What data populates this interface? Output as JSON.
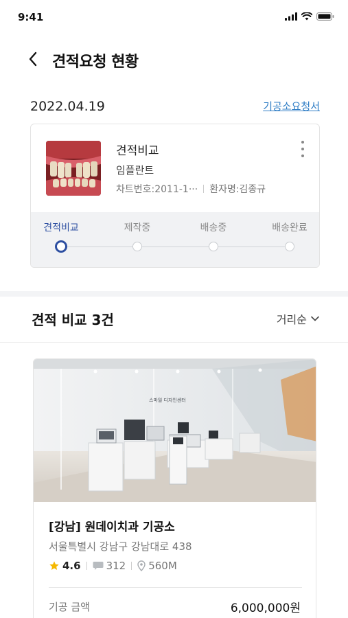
{
  "status": {
    "time": "9:41"
  },
  "header": {
    "title": "견적요청 현황"
  },
  "date_row": {
    "date": "2022.04.19",
    "request_link": "기공소요청서"
  },
  "order": {
    "title": "견적비교",
    "type": "임플란트",
    "chart_no": "차트번호:2011-1···",
    "patient": "환자명:김종규",
    "steps": [
      {
        "label": "견적비교",
        "active": true
      },
      {
        "label": "제작중",
        "active": false
      },
      {
        "label": "배송중",
        "active": false
      },
      {
        "label": "배송완료",
        "active": false
      }
    ]
  },
  "compare": {
    "title": "견적 비교 3건",
    "sort": "거리순"
  },
  "lab": {
    "name": "[강남] 원데이치과 기공소",
    "address": "서울특별시 강남구 강남대로 438",
    "rating": "4.6",
    "reviews": "312",
    "distance": "560M",
    "price_label": "기공 금액",
    "price": "6,000,000원",
    "photo_sign": "스마일 디자인센터"
  },
  "colors": {
    "accent": "#2d4fa1",
    "link": "#2f7dc5",
    "star": "#f5b800"
  }
}
